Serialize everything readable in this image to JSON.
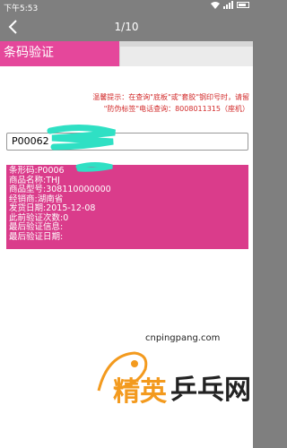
{
  "status_bar": {
    "time": "下午5:53"
  },
  "viewer": {
    "back_icon": "chevron-left-icon",
    "page_counter": "1/10"
  },
  "tab": {
    "active_label": "条码验证"
  },
  "notice": {
    "line1": "温馨提示：在查询\"底板\"或\"套胶\"钢印号时，请留",
    "line2": "\"防伪标签\"电话查询：8008011315（座机）"
  },
  "code_input": {
    "value": "P00062"
  },
  "result": {
    "barcode": "条形码:P0006",
    "product_name": "商品名称:THJ",
    "product_model": "商品型号:308110000000",
    "dealer": "经销商:湖南省",
    "ship_date": "发货日期:2015-12-08",
    "verify_count": "此前验证次数:0",
    "last_verify_info": "最后验证信息:",
    "last_verify_date": "最后验证日期:"
  },
  "watermark": {
    "url": "cnpingpang.com",
    "logo_left": "精英",
    "logo_right": "乒乓网"
  },
  "colors": {
    "accent": "#e5479b",
    "result_bg": "#da3c8b",
    "scribble": "#2fe0c4",
    "notice": "#d22a2a"
  }
}
